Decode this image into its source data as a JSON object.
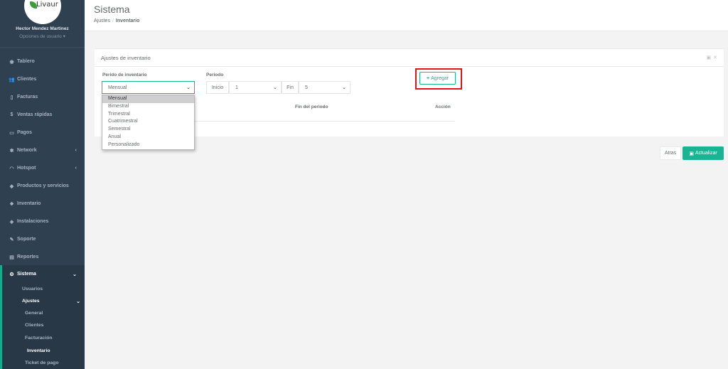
{
  "app": {
    "logo_text": "Livaur"
  },
  "user": {
    "name": "Hector Mendez Martinez",
    "options": "Opciones de usuario ▾"
  },
  "sidebar": {
    "items": [
      {
        "label": "Tablero",
        "icon": "dashboard-icon",
        "glyph": "◉"
      },
      {
        "label": "Clientes",
        "icon": "users-icon",
        "glyph": "👥"
      },
      {
        "label": "Facturas",
        "icon": "file-icon",
        "glyph": "▯"
      },
      {
        "label": "Ventas rápidas",
        "icon": "dollar-icon",
        "glyph": "$"
      },
      {
        "label": "Pagos",
        "icon": "money-icon",
        "glyph": "▭"
      },
      {
        "label": "Network",
        "icon": "network-icon",
        "glyph": "✱"
      },
      {
        "label": "Hotspot",
        "icon": "wifi-icon",
        "glyph": "◠"
      },
      {
        "label": "Productos y servicios",
        "icon": "tag-icon",
        "glyph": "◆"
      },
      {
        "label": "Inventario",
        "icon": "cubes-icon",
        "glyph": "❖"
      },
      {
        "label": "Instalaciones",
        "icon": "tools-icon",
        "glyph": "◈"
      },
      {
        "label": "Soporte",
        "icon": "wrench-icon",
        "glyph": "✎"
      },
      {
        "label": "Reportes",
        "icon": "book-icon",
        "glyph": "▤"
      },
      {
        "label": "Sistema",
        "icon": "cogs-icon",
        "glyph": "⚙"
      }
    ],
    "sub": {
      "usuarios": "Usuarios",
      "ajustes": "Ajustes",
      "general": "General",
      "clientes": "Clientes",
      "facturacion": "Facturación",
      "inventario": "Inventario",
      "ticket": "Ticket de pago"
    }
  },
  "header": {
    "title": "Sistema",
    "breadcrumb": {
      "parent": "Ajustes",
      "separator": "/",
      "current": "Inventario"
    }
  },
  "card": {
    "title": "Ajustes de inventario",
    "period_label": "Perido de inventario",
    "period_value": "Mensual",
    "range_label": "Periodo",
    "start_label": "Inicio",
    "start_value": "1",
    "end_label": "Fin",
    "end_value": "5",
    "add_button": "Agregar",
    "table_headers": {
      "end": "Fin del periodo",
      "action": "Acción"
    }
  },
  "dropdown_options": [
    "Mensual",
    "Bimestral",
    "Trimestral",
    "Cuatrimestral",
    "Semestral",
    "Anual",
    "Personalizado"
  ],
  "footer_buttons": {
    "back": "Atras",
    "update": "Actualizar"
  },
  "colors": {
    "sidebar": "#2f4050",
    "accent": "#1ab394",
    "highlight": "#e0141b"
  }
}
